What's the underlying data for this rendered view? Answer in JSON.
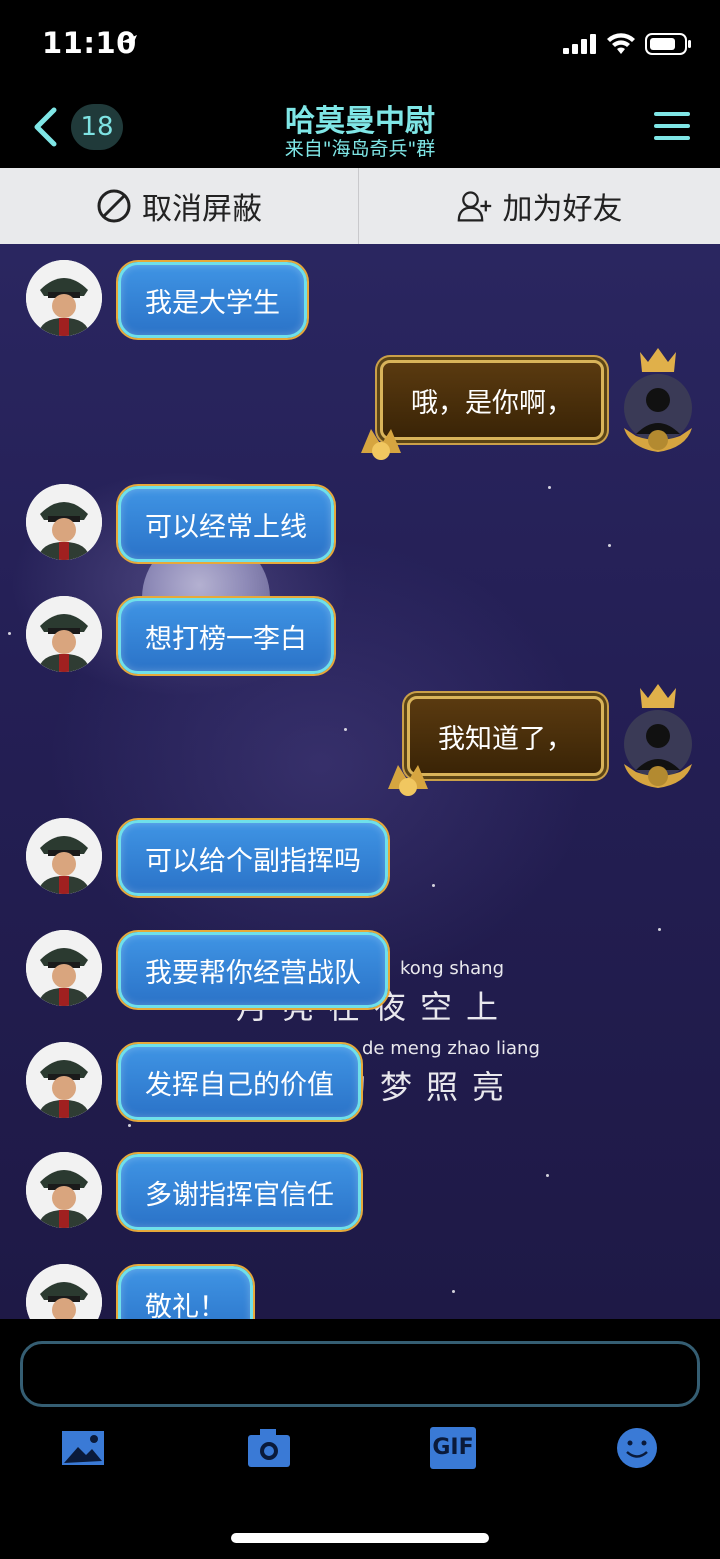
{
  "status_bar": {
    "time": "11:10"
  },
  "nav": {
    "unread_count": "18",
    "title": "哈莫曼中尉",
    "subtitle": "来自\"海岛奇兵\"群"
  },
  "actions": {
    "unblock_label": "取消屏蔽",
    "add_friend_label": "加为好友"
  },
  "messages": [
    {
      "side": "left",
      "text": "我是大学生"
    },
    {
      "side": "right",
      "text": "哦，是你啊，"
    },
    {
      "side": "left",
      "text": "可以经常上线"
    },
    {
      "side": "left",
      "text": "想打榜一李白"
    },
    {
      "side": "right",
      "text": "我知道了，"
    },
    {
      "side": "left",
      "text": "可以给个副指挥吗"
    },
    {
      "side": "left",
      "text": "我要帮你经营战队"
    },
    {
      "side": "left",
      "text": "发挥自己的价值"
    },
    {
      "side": "left",
      "text": "多谢指挥官信任"
    },
    {
      "side": "left",
      "text": "敬礼！"
    }
  ],
  "background_lyrics": {
    "pinyin_1": "kong shang",
    "line_1": "月亮在夜空上",
    "pinyin_2": "de meng zhao liang",
    "line_2": "的梦照亮"
  },
  "input": {
    "placeholder": ""
  },
  "toolbar": {
    "gif_label": "GIF"
  },
  "colors": {
    "accent": "#7fe6e6",
    "bubble_left": "#2b73c8",
    "bubble_right": "#3a2406"
  }
}
